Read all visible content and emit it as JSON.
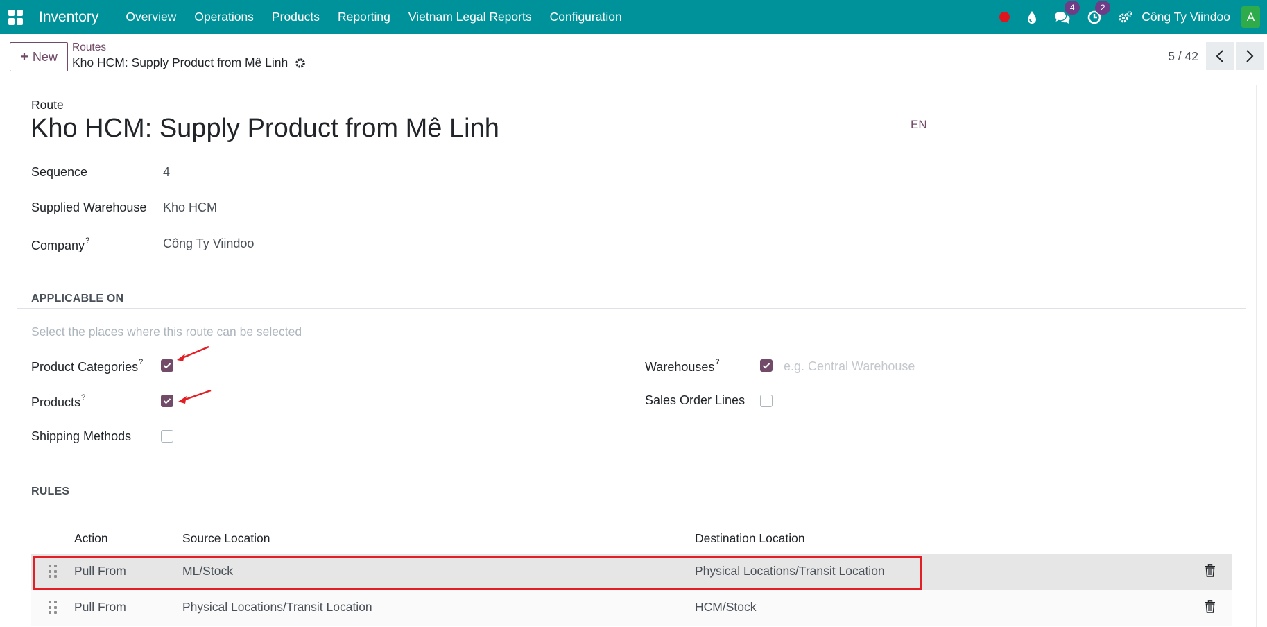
{
  "nav": {
    "app_name": "Inventory",
    "menu": [
      "Overview",
      "Operations",
      "Products",
      "Reporting",
      "Vietnam Legal Reports",
      "Configuration"
    ],
    "messages_badge": "4",
    "activities_badge": "2",
    "company": "Công Ty Viindoo",
    "avatar_letter": "A",
    "icons": [
      "apps-icon",
      "record-dot-icon",
      "droplet-icon",
      "chat-icon",
      "clock-icon",
      "settings-icon"
    ],
    "colors": {
      "navbar": "#00929a",
      "brand_purple": "#714b67",
      "badge": "#6f3c87",
      "avatar": "#2eab4a",
      "record": "#e0141c"
    }
  },
  "control": {
    "new_label": "New",
    "breadcrumb_parent": "Routes",
    "breadcrumb_current": "Kho HCM: Supply Product from Mê Linh",
    "pager": "5 / 42"
  },
  "form": {
    "route_label": "Route",
    "title": "Kho HCM: Supply Product from Mê Linh",
    "lang": "EN",
    "sequence_label": "Sequence",
    "sequence_value": "4",
    "warehouse_label": "Supplied Warehouse",
    "warehouse_value": "Kho HCM",
    "company_label": "Company",
    "company_help": "?",
    "company_value": "Công Ty Viindoo"
  },
  "applicable": {
    "section": "APPLICABLE ON",
    "hint": "Select the places where this route can be selected",
    "product_categories_label": "Product Categories",
    "product_categories_checked": true,
    "products_label": "Products",
    "products_checked": true,
    "shipping_methods_label": "Shipping Methods",
    "shipping_methods_checked": false,
    "warehouses_label": "Warehouses",
    "warehouses_checked": true,
    "warehouses_placeholder": "e.g. Central Warehouse",
    "sales_order_lines_label": "Sales Order Lines",
    "sales_order_lines_checked": false,
    "help": "?"
  },
  "rules": {
    "section": "RULES",
    "columns": [
      "Action",
      "Source Location",
      "Destination Location"
    ],
    "rows": [
      {
        "action": "Pull From",
        "source": "ML/Stock",
        "destination": "Physical Locations/Transit Location"
      },
      {
        "action": "Pull From",
        "source": "Physical Locations/Transit Location",
        "destination": "HCM/Stock"
      }
    ]
  }
}
